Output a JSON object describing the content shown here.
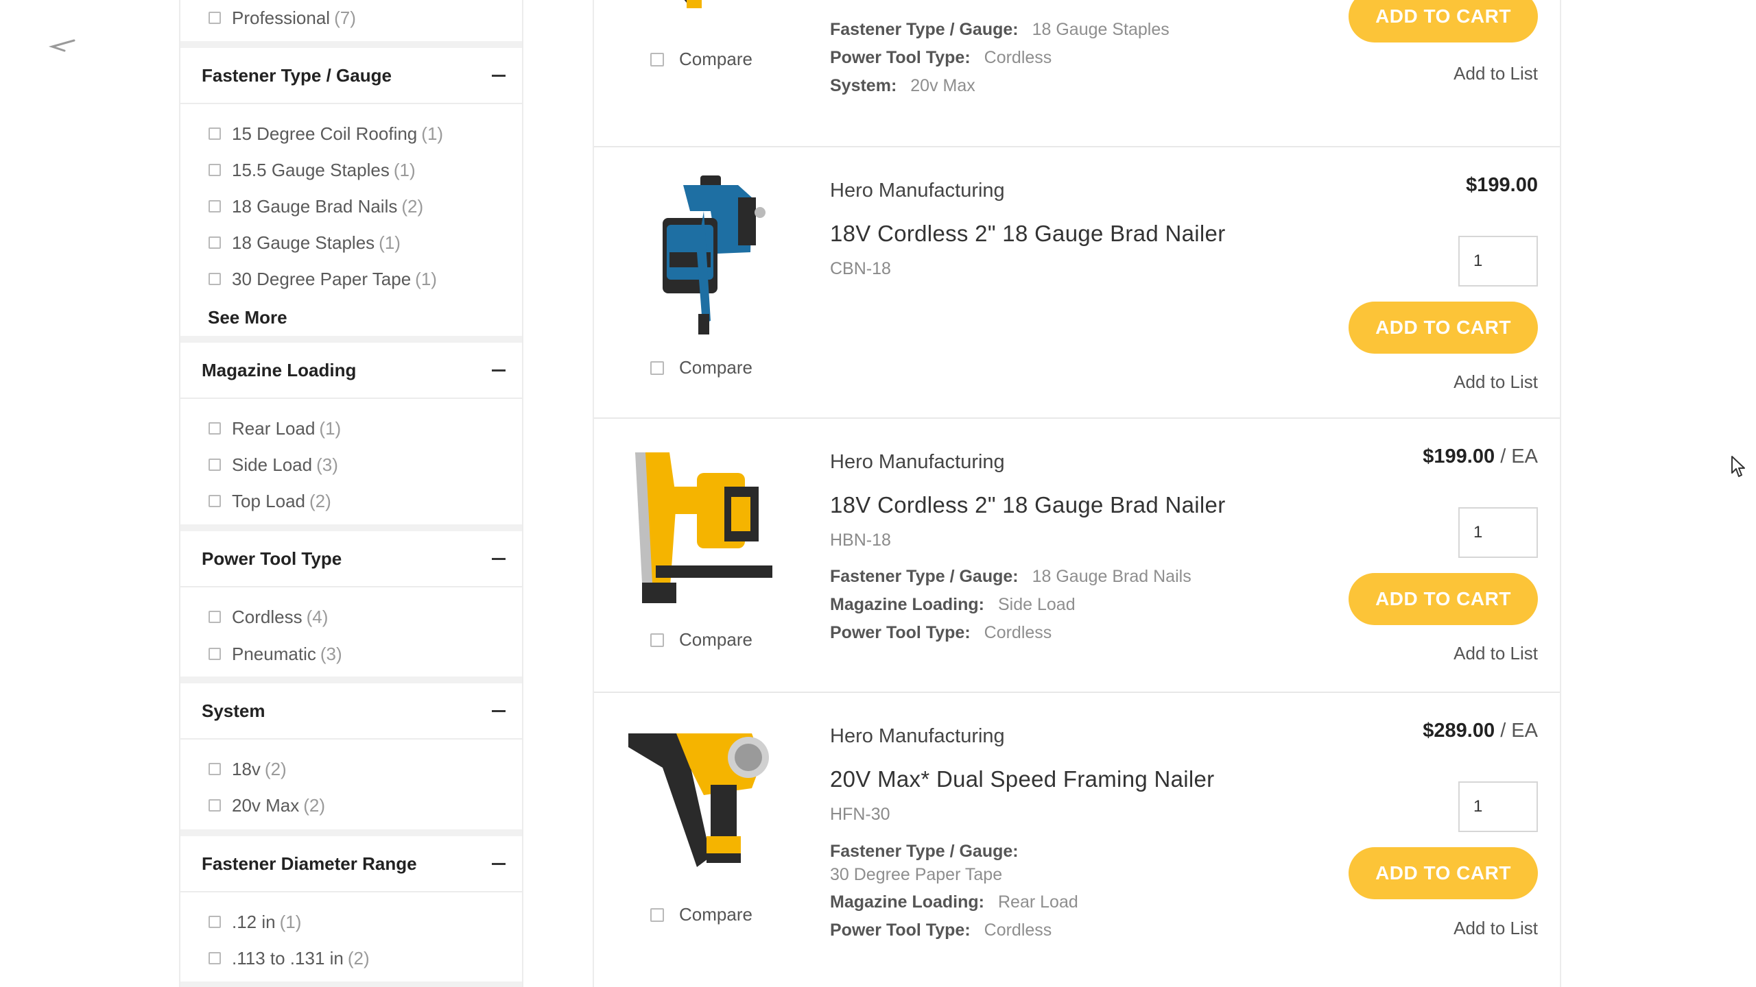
{
  "sidebar": {
    "top_item": {
      "label": "Professional",
      "count": "(7)"
    },
    "facets": [
      {
        "title": "Fastener Type / Gauge",
        "items": [
          {
            "label": "15 Degree Coil Roofing",
            "count": "(1)"
          },
          {
            "label": "15.5 Gauge Staples",
            "count": "(1)"
          },
          {
            "label": "18 Gauge Brad Nails",
            "count": "(2)"
          },
          {
            "label": "18 Gauge Staples",
            "count": "(1)"
          },
          {
            "label": "30 Degree Paper Tape",
            "count": "(1)"
          }
        ],
        "see_more": "See More"
      },
      {
        "title": "Magazine Loading",
        "items": [
          {
            "label": "Rear Load",
            "count": "(1)"
          },
          {
            "label": "Side Load",
            "count": "(3)"
          },
          {
            "label": "Top Load",
            "count": "(2)"
          }
        ]
      },
      {
        "title": "Power Tool Type",
        "items": [
          {
            "label": "Cordless",
            "count": "(4)"
          },
          {
            "label": "Pneumatic",
            "count": "(3)"
          }
        ]
      },
      {
        "title": "System",
        "items": [
          {
            "label": "18v",
            "count": "(2)"
          },
          {
            "label": "20v Max",
            "count": "(2)"
          }
        ]
      },
      {
        "title": "Fastener Diameter Range",
        "items": [
          {
            "label": ".12 in",
            "count": "(1)"
          },
          {
            "label": ".113 to .131 in",
            "count": "(2)"
          }
        ]
      }
    ]
  },
  "products": [
    {
      "compare": "Compare",
      "specs": [
        {
          "k": "Fastener Type / Gauge:",
          "v": "18 Gauge Staples"
        },
        {
          "k": "Power Tool Type:",
          "v": "Cordless"
        },
        {
          "k": "System:",
          "v": "20v Max"
        }
      ],
      "add_to_cart": "ADD TO CART",
      "add_to_list": "Add to List"
    },
    {
      "brand": "Hero Manufacturing",
      "name": "18V Cordless 2\" 18 Gauge Brad Nailer",
      "sku": "CBN-18",
      "price": "$199.00",
      "qty": "1",
      "compare": "Compare",
      "add_to_cart": "ADD TO CART",
      "add_to_list": "Add to List"
    },
    {
      "brand": "Hero Manufacturing",
      "name": "18V Cordless 2\" 18 Gauge Brad Nailer",
      "sku": "HBN-18",
      "price": "$199.00",
      "unit": "/ EA",
      "qty": "1",
      "compare": "Compare",
      "specs": [
        {
          "k": "Fastener Type / Gauge:",
          "v": "18 Gauge Brad Nails"
        },
        {
          "k": "Magazine Loading:",
          "v": "Side Load"
        },
        {
          "k": "Power Tool Type:",
          "v": "Cordless"
        }
      ],
      "add_to_cart": "ADD TO CART",
      "add_to_list": "Add to List"
    },
    {
      "brand": "Hero Manufacturing",
      "name": "20V Max* Dual Speed Framing Nailer",
      "sku": "HFN-30",
      "price": "$289.00",
      "unit": "/ EA",
      "qty": "1",
      "compare": "Compare",
      "specs": [
        {
          "k": "Fastener Type / Gauge:",
          "v": "30 Degree Paper Tape"
        },
        {
          "k": "Magazine Loading:",
          "v": "Rear Load"
        },
        {
          "k": "Power Tool Type:",
          "v": "Cordless"
        }
      ],
      "add_to_cart": "ADD TO CART",
      "add_to_list": "Add to List"
    }
  ],
  "colors": {
    "accent": "#fcc438",
    "tool_blue": "#1e6fa3",
    "tool_yellow": "#f5b400"
  }
}
